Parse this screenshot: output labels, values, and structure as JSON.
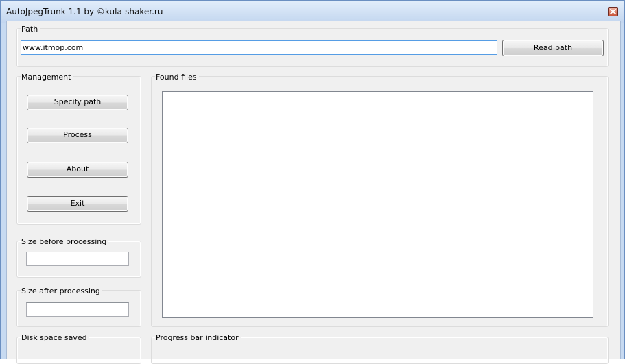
{
  "window": {
    "title": "AutoJpegTrunk 1.1 by ©kula-shaker.ru",
    "close_icon": "close-icon",
    "accent_color": "#c7daf1"
  },
  "path_group": {
    "label": "Path",
    "input_value": "www.itmop.com",
    "read_path_label": "Read path"
  },
  "management": {
    "label": "Management",
    "buttons": {
      "specify_path": "Specify path",
      "process": "Process",
      "about": "About",
      "exit": "Exit"
    }
  },
  "found_files": {
    "label": "Found files",
    "items": []
  },
  "size_before": {
    "label": "Size before processing",
    "value": ""
  },
  "size_after": {
    "label": "Size after processing",
    "value": ""
  },
  "disk_space": {
    "label": "Disk space saved"
  },
  "progress": {
    "label": "Progress bar indicator"
  }
}
